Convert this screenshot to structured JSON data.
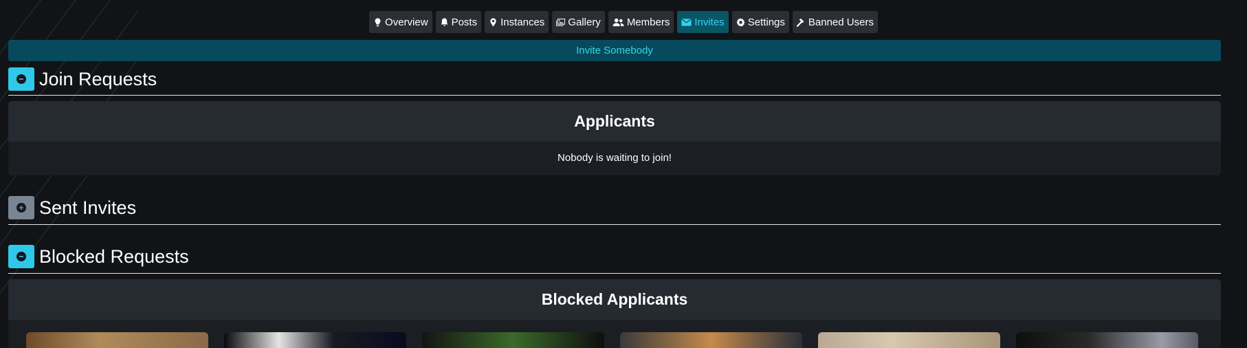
{
  "nav": {
    "tabs": [
      {
        "label": "Overview",
        "icon": "lightbulb-icon",
        "active": false
      },
      {
        "label": "Posts",
        "icon": "bell-icon",
        "active": false
      },
      {
        "label": "Instances",
        "icon": "map-pin-icon",
        "active": false
      },
      {
        "label": "Gallery",
        "icon": "images-icon",
        "active": false
      },
      {
        "label": "Members",
        "icon": "users-icon",
        "active": false
      },
      {
        "label": "Invites",
        "icon": "envelope-icon",
        "active": true
      },
      {
        "label": "Settings",
        "icon": "gear-icon",
        "active": false
      },
      {
        "label": "Banned Users",
        "icon": "gavel-icon",
        "active": false
      }
    ]
  },
  "invite_button": {
    "label": "Invite Somebody"
  },
  "sections": {
    "join_requests": {
      "title": "Join Requests",
      "expanded": true,
      "card_title": "Applicants",
      "empty_message": "Nobody is waiting to join!"
    },
    "sent_invites": {
      "title": "Sent Invites",
      "expanded": false
    },
    "blocked_requests": {
      "title": "Blocked Requests",
      "expanded": true,
      "card_title": "Blocked Applicants"
    }
  },
  "colors": {
    "accent": "#2fc8e8",
    "active_tab_bg": "#0a5566",
    "invite_bar_bg": "#074a5b",
    "page_bg": "#111317"
  }
}
